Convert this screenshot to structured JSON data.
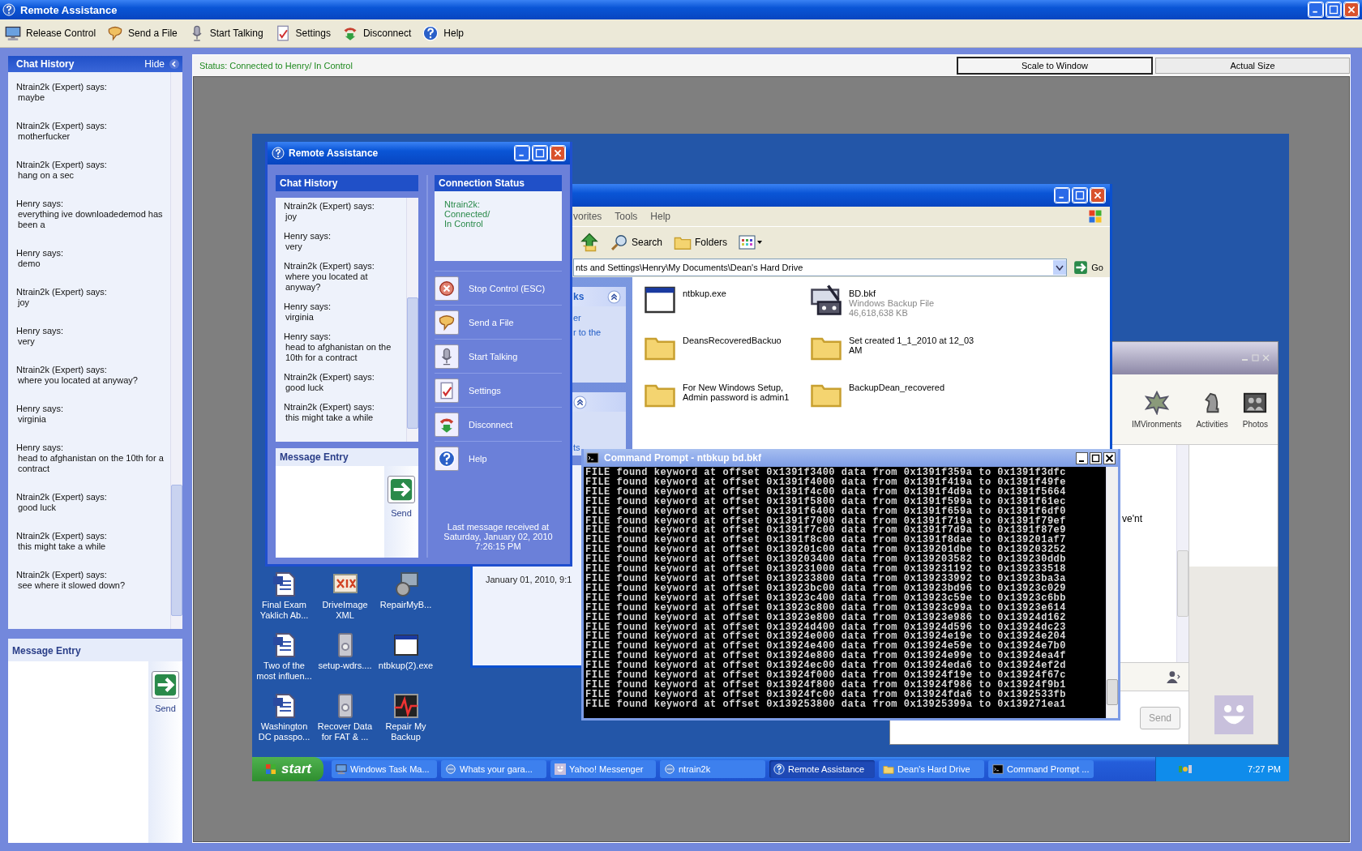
{
  "window": {
    "title": "Remote Assistance"
  },
  "toolbar": [
    {
      "label": "Release Control"
    },
    {
      "label": "Send a File"
    },
    {
      "label": "Start Talking"
    },
    {
      "label": "Settings"
    },
    {
      "label": "Disconnect"
    },
    {
      "label": "Help"
    }
  ],
  "chat_panel": {
    "title": "Chat History",
    "hide": "Hide",
    "messages": [
      {
        "sender": "Ntrain2k (Expert) says:",
        "text": "maybe"
      },
      {
        "sender": "Ntrain2k (Expert) says:",
        "text": "motherfucker"
      },
      {
        "sender": "Ntrain2k (Expert) says:",
        "text": "hang on a sec"
      },
      {
        "sender": "Henry says:",
        "text": "everything ive downloadedemod has been a"
      },
      {
        "sender": "Henry says:",
        "text": "demo"
      },
      {
        "sender": "Ntrain2k (Expert) says:",
        "text": "joy"
      },
      {
        "sender": "Henry says:",
        "text": "very"
      },
      {
        "sender": "Ntrain2k (Expert) says:",
        "text": "where you located at anyway?"
      },
      {
        "sender": "Henry says:",
        "text": "virginia"
      },
      {
        "sender": "Henry says:",
        "text": "head to afghanistan on the 10th for a contract"
      },
      {
        "sender": "Ntrain2k (Expert) says:",
        "text": "good luck"
      },
      {
        "sender": "Ntrain2k (Expert) says:",
        "text": "this might take a while"
      },
      {
        "sender": "Ntrain2k (Expert) says:",
        "text": "see where it slowed down?"
      }
    ],
    "entry_title": "Message Entry",
    "send": "Send"
  },
  "status": "Status: Connected to Henry/ In Control",
  "view_buttons": [
    {
      "label": "Scale to Window",
      "selected": true
    },
    {
      "label": "Actual Size",
      "selected": false
    }
  ],
  "remote_desktop": {
    "assistance_window": {
      "title": "Remote Assistance",
      "chat_title": "Chat History",
      "messages": [
        {
          "sender": "Ntrain2k (Expert) says:",
          "text": "joy"
        },
        {
          "sender": "Henry says:",
          "text": "very"
        },
        {
          "sender": "Ntrain2k (Expert) says:",
          "text": "where you located at anyway?"
        },
        {
          "sender": "Henry says:",
          "text": "virginia"
        },
        {
          "sender": "Henry says:",
          "text": "head to afghanistan on the 10th for a contract"
        },
        {
          "sender": "Ntrain2k (Expert) says:",
          "text": "good luck"
        },
        {
          "sender": "Ntrain2k (Expert) says:",
          "text": "this might take a while"
        }
      ],
      "entry_title": "Message Entry",
      "send": "Send",
      "status_title": "Connection Status",
      "status_lines": [
        "Ntrain2k:",
        "Connected/",
        "In Control"
      ],
      "actions": [
        {
          "label": "Stop Control (ESC)"
        },
        {
          "label": "Send a File"
        },
        {
          "label": "Start Talking"
        },
        {
          "label": "Settings"
        },
        {
          "label": "Disconnect"
        },
        {
          "label": "Help"
        }
      ],
      "last_message": [
        "Last message received at",
        "Saturday, January 02, 2010",
        "7:26:15 PM"
      ]
    },
    "explorer": {
      "menu": [
        "vorites",
        "Tools",
        "Help"
      ],
      "tools": [
        "Search",
        "Folders"
      ],
      "address": "nts and Settings\\Henry\\My Documents\\Dean's Hard Drive",
      "go": "Go",
      "task_header": "ks",
      "task_links": [
        "er",
        "r to the"
      ],
      "task_fragment": "ts",
      "details_fragment": "January 01, 2010, 9:1",
      "files": [
        {
          "kind": "app",
          "name": "ntbkup.exe"
        },
        {
          "kind": "backup",
          "name": "BD.bkf",
          "type": "Windows Backup File",
          "size": "46,618,638 KB"
        },
        {
          "kind": "folder",
          "name": "DeansRecoveredBackuo"
        },
        {
          "kind": "folder",
          "name": "Set created 1_1_2010 at 12_03 AM"
        },
        {
          "kind": "folder",
          "name": "For New Windows Setup, Admin password is admin1"
        },
        {
          "kind": "folder",
          "name": "BackupDean_recovered"
        }
      ]
    },
    "messenger": {
      "tools": [
        "IMVironments",
        "Activities",
        "Photos"
      ],
      "message_fragment": "ve'nt",
      "send": "Send"
    },
    "command_prompt": {
      "title": "Command Prompt - ntbkup bd.bkf",
      "lines": [
        "FILE found keyword at offset 0x1391f3400 data from 0x1391f359a to 0x1391f3dfc",
        "FILE found keyword at offset 0x1391f4000 data from 0x1391f419a to 0x1391f49fe",
        "FILE found keyword at offset 0x1391f4c00 data from 0x1391f4d9a to 0x1391f5664",
        "FILE found keyword at offset 0x1391f5800 data from 0x1391f599a to 0x1391f61ec",
        "FILE found keyword at offset 0x1391f6400 data from 0x1391f659a to 0x1391f6df0",
        "FILE found keyword at offset 0x1391f7000 data from 0x1391f719a to 0x1391f79ef",
        "FILE found keyword at offset 0x1391f7c00 data from 0x1391f7d9a to 0x1391f87e9",
        "FILE found keyword at offset 0x1391f8c00 data from 0x1391f8dae to 0x139201af7",
        "FILE found keyword at offset 0x139201c00 data from 0x139201dbe to 0x139203252",
        "FILE found keyword at offset 0x139203400 data from 0x139203582 to 0x139230ddb",
        "FILE found keyword at offset 0x139231000 data from 0x139231192 to 0x139233518",
        "FILE found keyword at offset 0x139233800 data from 0x139233992 to 0x13923ba3a",
        "FILE found keyword at offset 0x13923bc00 data from 0x13923bd96 to 0x13923c029",
        "FILE found keyword at offset 0x13923c400 data from 0x13923c59e to 0x13923c6bb",
        "FILE found keyword at offset 0x13923c800 data from 0x13923c99a to 0x13923e614",
        "FILE found keyword at offset 0x13923e800 data from 0x13923e986 to 0x13924d162",
        "FILE found keyword at offset 0x13924d400 data from 0x13924d596 to 0x13924dc23",
        "FILE found keyword at offset 0x13924e000 data from 0x13924e19e to 0x13924e204",
        "FILE found keyword at offset 0x13924e400 data from 0x13924e59e to 0x13924e7b0",
        "FILE found keyword at offset 0x13924e800 data from 0x13924e99e to 0x13924ea4f",
        "FILE found keyword at offset 0x13924ec00 data from 0x13924eda6 to 0x13924ef2d",
        "FILE found keyword at offset 0x13924f000 data from 0x13924f19e to 0x13924f67c",
        "FILE found keyword at offset 0x13924f800 data from 0x13924f986 to 0x13924f9b1",
        "FILE found keyword at offset 0x13924fc00 data from 0x13924fda6 to 0x1392533fb",
        "FILE found keyword at offset 0x139253800 data from 0x13925399a to 0x139271ea1"
      ]
    },
    "desktop_icons": [
      {
        "kind": "word",
        "label": "Final Exam Yaklich Ab..."
      },
      {
        "kind": "diskimage",
        "label": "DriveImage XML"
      },
      {
        "kind": "installer",
        "label": "RepairMyB..."
      },
      {
        "kind": "word",
        "label": "Two of the most influen..."
      },
      {
        "kind": "setup",
        "label": "setup-wdrs...."
      },
      {
        "kind": "app",
        "label": "ntbkup(2).exe"
      },
      {
        "kind": "word",
        "label": "Washington DC passpo..."
      },
      {
        "kind": "setup",
        "label": "Recover Data for FAT & ..."
      },
      {
        "kind": "repair",
        "label": "Repair My Backup"
      }
    ],
    "taskbar": {
      "start": "start",
      "items": [
        {
          "label": "Windows Task Ma...",
          "selected": false
        },
        {
          "label": "Whats your gara...",
          "selected": false
        },
        {
          "label": "Yahoo! Messenger",
          "selected": false
        },
        {
          "label": "ntrain2k",
          "selected": false
        },
        {
          "label": "Remote Assistance",
          "selected": true
        },
        {
          "label": "Dean's Hard Drive",
          "selected": false
        },
        {
          "label": "Command Prompt ...",
          "selected": false
        }
      ],
      "clock": "7:27 PM"
    }
  }
}
